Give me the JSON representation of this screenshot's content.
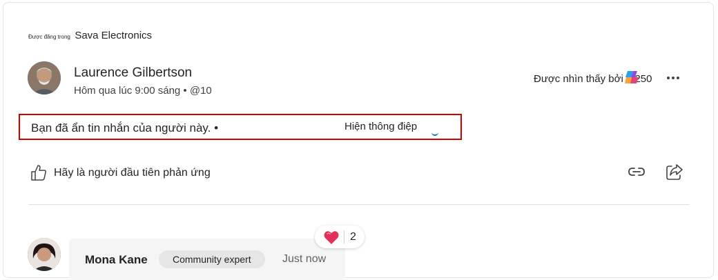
{
  "post": {
    "posted_in_prefix": "Được đăng trong",
    "community": "Sava Electronics",
    "author": "Laurence Gilbertson",
    "meta": "Hôm qua lúc 9:00 sáng • @10",
    "seen_by": "Được nhìn thấy bởi 1.250",
    "hidden_notice": "Bạn đã ẩn tin nhắn của người này. •",
    "show_message_label": "Hiện thông điệp",
    "react_prompt": "Hãy là người đầu tiên phản ứng"
  },
  "reply": {
    "author": "Mona Kane",
    "badge": "Community expert",
    "time": "Just now",
    "reaction_count": "2"
  },
  "icons": {
    "more": "more-icon",
    "like": "like-icon",
    "link": "link-icon",
    "share": "share-icon",
    "copilot": "copilot-icon",
    "heart": "heart-icon"
  },
  "colors": {
    "highlight_border": "#d40000",
    "accent": "#0f6cbd",
    "heart": "#e3305a"
  }
}
